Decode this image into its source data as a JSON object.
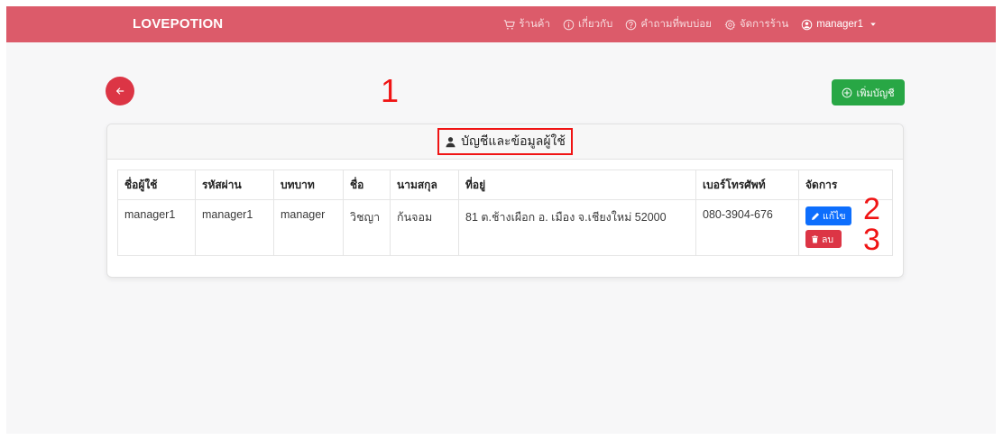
{
  "colors": {
    "navbar": "#dc5b6a",
    "page_background": "#f7f7f8",
    "danger": "#dc3545",
    "success": "#28a745",
    "primary": "#0d6efd",
    "annotation": "#f01414"
  },
  "nav": {
    "brand": "LOVEPOTION",
    "items": [
      {
        "icon": "cart-icon",
        "label": "ร้านค้า"
      },
      {
        "icon": "info-icon",
        "label": "เกี่ยวกับ"
      },
      {
        "icon": "question-circle-icon",
        "label": "คำถามที่พบบ่อย"
      },
      {
        "icon": "gear-icon",
        "label": "จัดการร้าน"
      },
      {
        "icon": "user-circle-icon",
        "label": "manager1",
        "dropdown_icon": "caret-down-icon"
      }
    ]
  },
  "toolbar": {
    "back_button_icon": "arrow-left-icon",
    "add_account": {
      "icon": "plus-circle-icon",
      "label": "เพิ่มบัญชี"
    }
  },
  "card": {
    "header_icon": "user-icon",
    "title": "บัญชีและข้อมูลผู้ใช้",
    "table": {
      "columns": [
        "ชื่อผู้ใช้",
        "รหัสผ่าน",
        "บทบาท",
        "ชื่อ",
        "นามสกุล",
        "ที่อยู่",
        "เบอร์โทรศัพท์",
        "จัดการ"
      ],
      "rows": [
        {
          "username": "manager1",
          "password": "manager1",
          "role": "manager",
          "first_name": "วิชญา",
          "last_name": "ก้นจอม",
          "address": "81 ต.ช้างเผือก อ. เมือง จ.เชียงใหม่ 52000",
          "phone": "080-3904-676",
          "actions": {
            "edit": {
              "icon": "pencil-icon",
              "label": "แก้ไข"
            },
            "delete": {
              "icon": "trash-icon",
              "label": "ลบ"
            }
          }
        }
      ]
    }
  },
  "annotations": {
    "marker_1": "1",
    "marker_2": "2",
    "marker_3": "3"
  }
}
